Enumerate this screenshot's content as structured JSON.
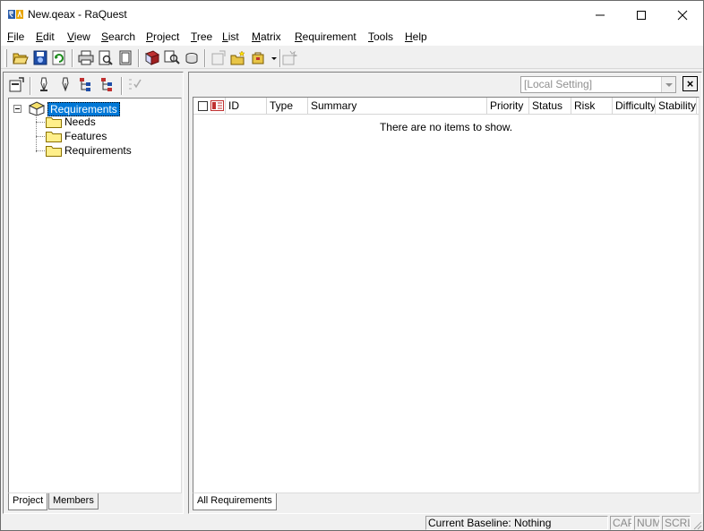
{
  "window": {
    "title": "New.qeax - RaQuest"
  },
  "menu": [
    {
      "label_pre": "",
      "accel": "F",
      "label_post": "ile"
    },
    {
      "label_pre": "",
      "accel": "E",
      "label_post": "dit"
    },
    {
      "label_pre": "",
      "accel": "V",
      "label_post": "iew"
    },
    {
      "label_pre": "",
      "accel": "S",
      "label_post": "earch"
    },
    {
      "label_pre": "",
      "accel": "P",
      "label_post": "roject"
    },
    {
      "label_pre": "",
      "accel": "T",
      "label_post": "ree"
    },
    {
      "label_pre": "",
      "accel": "L",
      "label_post": "ist"
    },
    {
      "label_pre": "",
      "accel": "M",
      "label_post": "atrix"
    },
    {
      "label_pre": "",
      "accel": "R",
      "label_post": "equirement"
    },
    {
      "label_pre": "",
      "accel": "T",
      "label_post": "ools"
    },
    {
      "label_pre": "",
      "accel": "H",
      "label_post": "elp"
    }
  ],
  "toolbar": {
    "icons": [
      "open-icon",
      "save-icon",
      "refresh-icon",
      "print-icon",
      "print-preview-icon",
      "page-icon",
      "book-icon",
      "find-icon",
      "database-icon",
      "properties-icon",
      "new-folder-icon",
      "new-item-icon",
      "settings-icon"
    ]
  },
  "tree": {
    "root": "Requirements",
    "children": [
      "Needs",
      "Features",
      "Requirements"
    ]
  },
  "left_tabs": [
    "Project",
    "Members"
  ],
  "filter": {
    "value": "[Local Setting]",
    "close": "×"
  },
  "list": {
    "columns": [
      "ID",
      "Type",
      "Summary",
      "Priority",
      "Status",
      "Risk",
      "Difficulty",
      "Stability"
    ],
    "empty_message": "There are no items to show."
  },
  "right_tabs": [
    "All Requirements"
  ],
  "status": {
    "baseline": "Current Baseline: Nothing",
    "cap": "CAP",
    "num": "NUM",
    "scrl": "SCRL"
  }
}
